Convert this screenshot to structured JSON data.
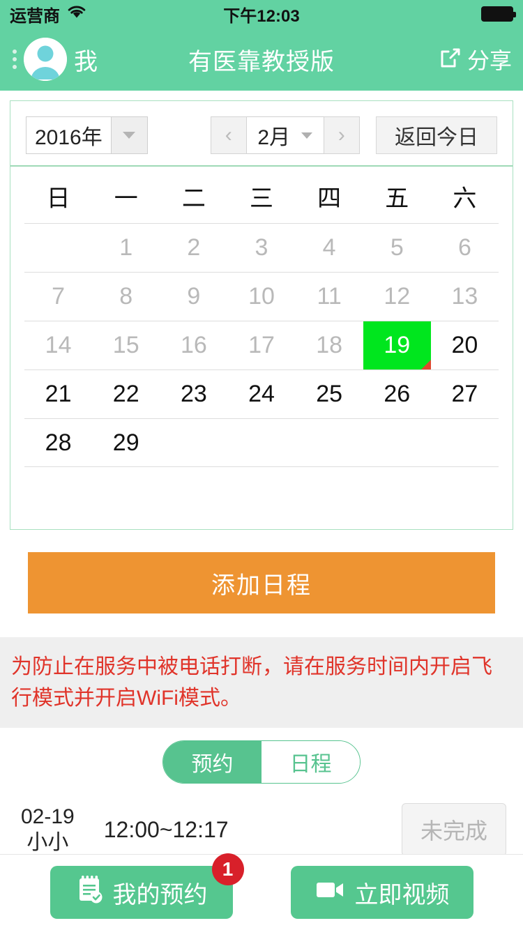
{
  "status_bar": {
    "carrier": "运营商",
    "wifi_icon": "wifi-icon",
    "time": "下午12:03",
    "battery_icon": "battery-full-icon"
  },
  "nav": {
    "menu_icon": "kebab-menu-icon",
    "avatar_icon": "user-avatar-icon",
    "profile_label": "我",
    "title": "有医靠教授版",
    "share_icon": "share-icon",
    "share_label": "分享"
  },
  "calendar": {
    "year_value": "2016年",
    "year_dropdown_icon": "chevron-down-icon",
    "prev_month_icon": "chevron-left-icon",
    "month_value": "2月",
    "month_dropdown_icon": "chevron-down-icon",
    "next_month_icon": "chevron-right-icon",
    "today_button": "返回今日",
    "weekdays": [
      "日",
      "一",
      "二",
      "三",
      "四",
      "五",
      "六"
    ],
    "selected_day": "19",
    "today_bg_color": "#00e61e",
    "marker_color": "#e0482f",
    "rows": [
      [
        {
          "label": "",
          "state": "empty"
        },
        {
          "label": "1",
          "state": "past"
        },
        {
          "label": "2",
          "state": "past"
        },
        {
          "label": "3",
          "state": "past"
        },
        {
          "label": "4",
          "state": "past"
        },
        {
          "label": "5",
          "state": "past"
        },
        {
          "label": "6",
          "state": "past"
        }
      ],
      [
        {
          "label": "7",
          "state": "past"
        },
        {
          "label": "8",
          "state": "past"
        },
        {
          "label": "9",
          "state": "past"
        },
        {
          "label": "10",
          "state": "past"
        },
        {
          "label": "11",
          "state": "past"
        },
        {
          "label": "12",
          "state": "past"
        },
        {
          "label": "13",
          "state": "past"
        }
      ],
      [
        {
          "label": "14",
          "state": "past"
        },
        {
          "label": "15",
          "state": "past"
        },
        {
          "label": "16",
          "state": "past"
        },
        {
          "label": "17",
          "state": "past"
        },
        {
          "label": "18",
          "state": "past"
        },
        {
          "label": "19",
          "state": "today"
        },
        {
          "label": "20",
          "state": "future"
        }
      ],
      [
        {
          "label": "21",
          "state": "future"
        },
        {
          "label": "22",
          "state": "future"
        },
        {
          "label": "23",
          "state": "future"
        },
        {
          "label": "24",
          "state": "future"
        },
        {
          "label": "25",
          "state": "future"
        },
        {
          "label": "26",
          "state": "future"
        },
        {
          "label": "27",
          "state": "future"
        }
      ],
      [
        {
          "label": "28",
          "state": "future"
        },
        {
          "label": "29",
          "state": "future"
        },
        {
          "label": "",
          "state": "empty"
        },
        {
          "label": "",
          "state": "empty"
        },
        {
          "label": "",
          "state": "empty"
        },
        {
          "label": "",
          "state": "empty"
        },
        {
          "label": "",
          "state": "empty"
        }
      ]
    ]
  },
  "add_schedule": {
    "label": "添加日程",
    "color": "#ee9432"
  },
  "warning": {
    "text": "为防止在服务中被电话打断，请在服务时间内开启飞行模式并开启WiFi模式。",
    "color": "#e0342a"
  },
  "segmented": {
    "active_label": "预约",
    "idle_label": "日程",
    "active_color": "#57c38f"
  },
  "appointments": {
    "rows": [
      {
        "date": "02-19",
        "name": "小小",
        "time": "12:00~12:17",
        "status": "未完成"
      }
    ]
  },
  "bottom_bar": {
    "my_appointments": {
      "icon": "notepad-check-icon",
      "label": "我的预约",
      "badge": "1",
      "badge_color": "#d8202a"
    },
    "start_video": {
      "icon": "video-camera-icon",
      "label": "立即视频"
    }
  }
}
